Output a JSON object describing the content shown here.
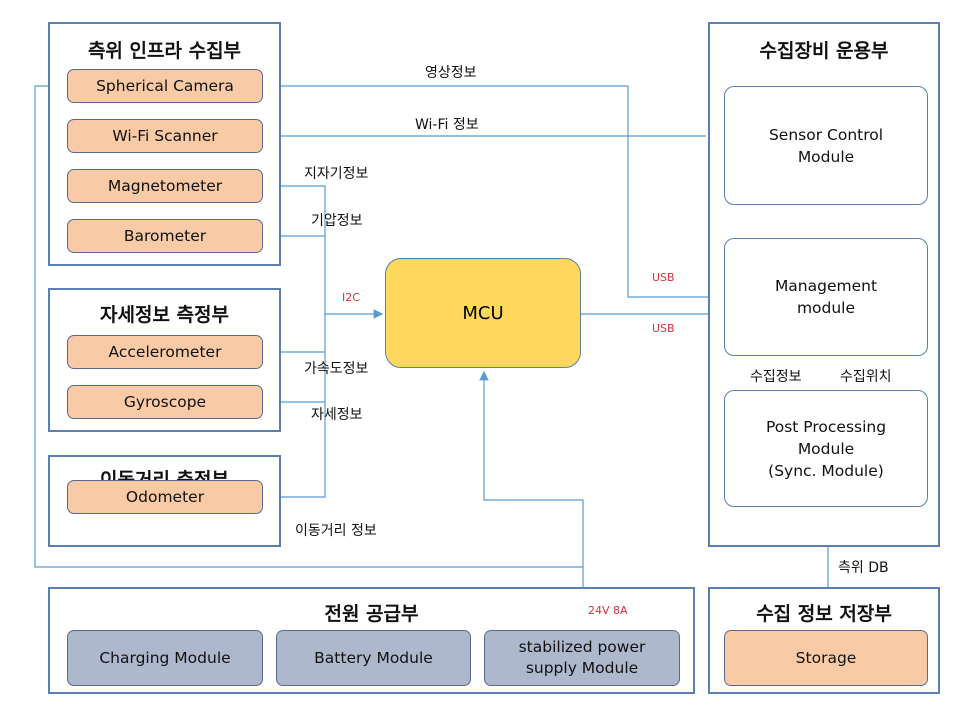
{
  "colors": {
    "sensor": "#f8cba6",
    "power": "#adb8cc",
    "mcu": "#fdd85d",
    "line": "#5b9bd5",
    "border": "#5a7fb0",
    "interface_label": "#d0323c"
  },
  "groups": {
    "positioning": {
      "title": "측위 인프라 수집부",
      "items": [
        "Spherical Camera",
        "Wi-Fi Scanner",
        "Magnetometer",
        "Barometer"
      ]
    },
    "attitude": {
      "title": "자세정보 측정부",
      "items": [
        "Accelerometer",
        "Gyroscope"
      ]
    },
    "distance": {
      "title": "이동거리 측정부",
      "items": [
        "Odometer"
      ]
    },
    "power": {
      "title": "전원 공급부",
      "items": [
        "Charging Module",
        "Battery Module",
        "stabilized power\nsupply Module"
      ]
    },
    "operation": {
      "title": "수집장비 운용부",
      "items": [
        "Sensor Control\nModule",
        "Management\nmodule",
        "Post Processing\nModule\n(Sync. Module)"
      ]
    },
    "storage": {
      "title": "수집 정보 저장부",
      "items": [
        "Storage"
      ]
    }
  },
  "mcu": "MCU",
  "labels": {
    "video": "영상정보",
    "wifi": "Wi-Fi 정보",
    "mag": "지자기정보",
    "baro": "기압정보",
    "i2c": "I2C",
    "usb1": "USB",
    "usb2": "USB",
    "accel": "가속도정보",
    "gyro": "자세정보",
    "odo": "이동거리 정보",
    "power": "24V 8A",
    "collect_info": "수집정보",
    "collect_pos": "수집위치",
    "db": "측위 DB"
  }
}
